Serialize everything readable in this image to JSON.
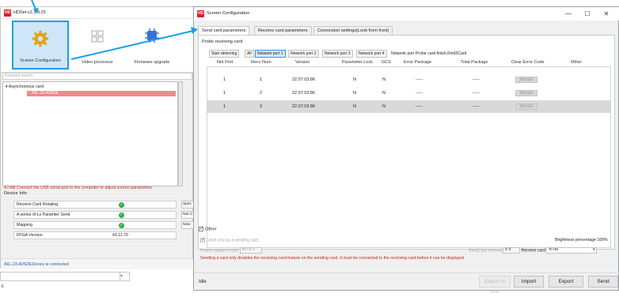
{
  "hdset": {
    "title": "HDSet-v2.1.8.25",
    "logo": "HD",
    "toolbar": [
      {
        "label": "Screen Configuration",
        "icon": "gear-icon"
      },
      {
        "label": "Video processor",
        "icon": "grid-icon"
      },
      {
        "label": "Firmware upgrade",
        "icon": "chip-icon"
      }
    ],
    "keyword_search": "Keyword search",
    "tree_root": "Asynchronous card",
    "tree_device": "A6L-23-A0SDE",
    "warning": "A7/A8 Connect the USB serial port to the computer to adjust screen parameters",
    "device_info": "Device Info",
    "info_rows": [
      {
        "label": "Receive Card Rotating",
        "side": "Spec"
      },
      {
        "label": "A series of Ls Paramter Send",
        "side": "Net C"
      },
      {
        "label": "Mapping",
        "side": "New"
      },
      {
        "label": "FPGA Version",
        "value": "43.11.70"
      }
    ],
    "status": "A6L-23-A0SDEDevice is connected"
  },
  "dialog": {
    "title": "Screen Configuration",
    "logo": "HD",
    "minimize": "—",
    "maximize": "☐",
    "close": "✕",
    "tabs": [
      "Send card parameters",
      "Receive card parameters",
      "Connection settings(Look from front)"
    ],
    "probe_label": "Probe receiving card",
    "probe_buttons": [
      "Start detecting",
      "All",
      "Network port 1",
      "Network port 2",
      "Network port 3",
      "Network port 4"
    ],
    "probe_status": "Network port Probe card finish.Find3Card",
    "columns": [
      "Net Port",
      "Recv Num",
      "Version",
      "Parameter Lock",
      "GCS",
      "Error Package",
      "Total Package",
      "Clear Error Code",
      "Other"
    ],
    "rows": [
      {
        "port": "1",
        "recv": "1",
        "version": "22.07.03.86",
        "lock": "N",
        "gcs": "N",
        "error": "-----",
        "total": "-----",
        "clear": "清除误码"
      },
      {
        "port": "1",
        "recv": "2",
        "version": "22.07.03.86",
        "lock": "N",
        "gcs": "N",
        "error": "-----",
        "total": "-----",
        "clear": "清除误码"
      },
      {
        "port": "1",
        "recv": "3",
        "version": "22.07.03.86",
        "lock": "N",
        "gcs": "N",
        "error": "-----",
        "total": "-----",
        "clear": "清除误码"
      }
    ],
    "other_label": "Other",
    "sending_only": "Used only as a sending card",
    "brightness": "Brightness percentage  100%",
    "frame_capture": "Frame capture mode",
    "frame_value": "60 Hz",
    "sendcard_interval": "SendCard Interval",
    "interval_value": "0",
    "receive_card": "Receive card",
    "receive_card_value": "R-HD",
    "note": "Sending a card only disables the receiving card feature on the sending card. It must be connected to the receiving card before it can be displayed.",
    "status": "Idle",
    "buttons": {
      "export_usb": "Export to usb",
      "import": "Import",
      "export": "Export",
      "send": "Send"
    }
  },
  "colors": {
    "accent": "#18a0e6",
    "warning": "#d02020",
    "brand": "#d2222a",
    "selected_row": "#d9d9d9"
  }
}
